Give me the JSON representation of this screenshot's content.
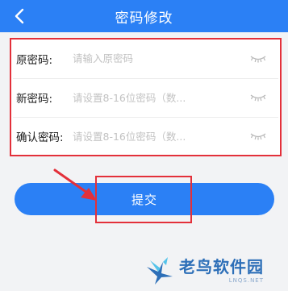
{
  "header": {
    "title": "密码修改"
  },
  "form": {
    "rows": [
      {
        "label": "原密码:",
        "placeholder": "请输入原密码",
        "value": ""
      },
      {
        "label": "新密码:",
        "placeholder": "请设置8-16位密码（数...",
        "value": ""
      },
      {
        "label": "确认密码:",
        "placeholder": "请设置8-16位密码（数...",
        "value": ""
      }
    ]
  },
  "submit": {
    "label": "提交"
  },
  "watermark": {
    "text": "老鸟软件园",
    "sub": "LNQS.NET"
  },
  "colors": {
    "primary": "#2b80f5",
    "highlight": "#e3303a",
    "background": "#f2f3f5"
  },
  "icons": {
    "back": "chevron-left-icon",
    "eye": "eye-closed-icon"
  }
}
